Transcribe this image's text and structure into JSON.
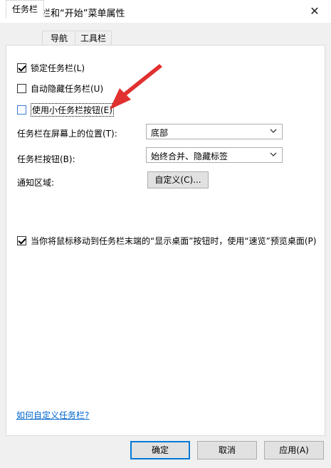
{
  "window": {
    "title": "任务栏和“开始”菜单属性",
    "close_glyph": "✕"
  },
  "tabs": [
    {
      "label": "任务栏",
      "active": true
    },
    {
      "label": "导航",
      "active": false
    },
    {
      "label": "工具栏",
      "active": false
    }
  ],
  "options": {
    "lock_taskbar": {
      "label": "锁定任务栏(L)",
      "checked": true
    },
    "auto_hide": {
      "label": "自动隐藏任务栏(U)",
      "checked": false
    },
    "small_buttons": {
      "label": "使用小任务栏按钮(E)",
      "checked": false
    }
  },
  "settings": {
    "position": {
      "label": "任务栏在屏幕上的位置(T):",
      "value": "底部"
    },
    "buttons": {
      "label": "任务栏按钮(B):",
      "value": "始终合并、隐藏标签"
    },
    "notification": {
      "label": "通知区域:",
      "button": "自定义(C)..."
    }
  },
  "peek": {
    "label": "当你将鼠标移动到任务栏末端的“显示桌面”按钮时，使用“速览”预览桌面(P)",
    "checked": true
  },
  "help_link": "如何自定义任务栏?",
  "footer": {
    "ok": "确定",
    "cancel": "取消",
    "apply": "应用(A)"
  },
  "colors": {
    "accent": "#0078d7",
    "link": "#0066cc",
    "annotation_arrow": "#e03030"
  },
  "icons": {
    "title": "checkbox-app-icon",
    "close": "close-icon",
    "dropdown": "chevron-down-icon",
    "annotation": "red-arrow-annotation"
  }
}
